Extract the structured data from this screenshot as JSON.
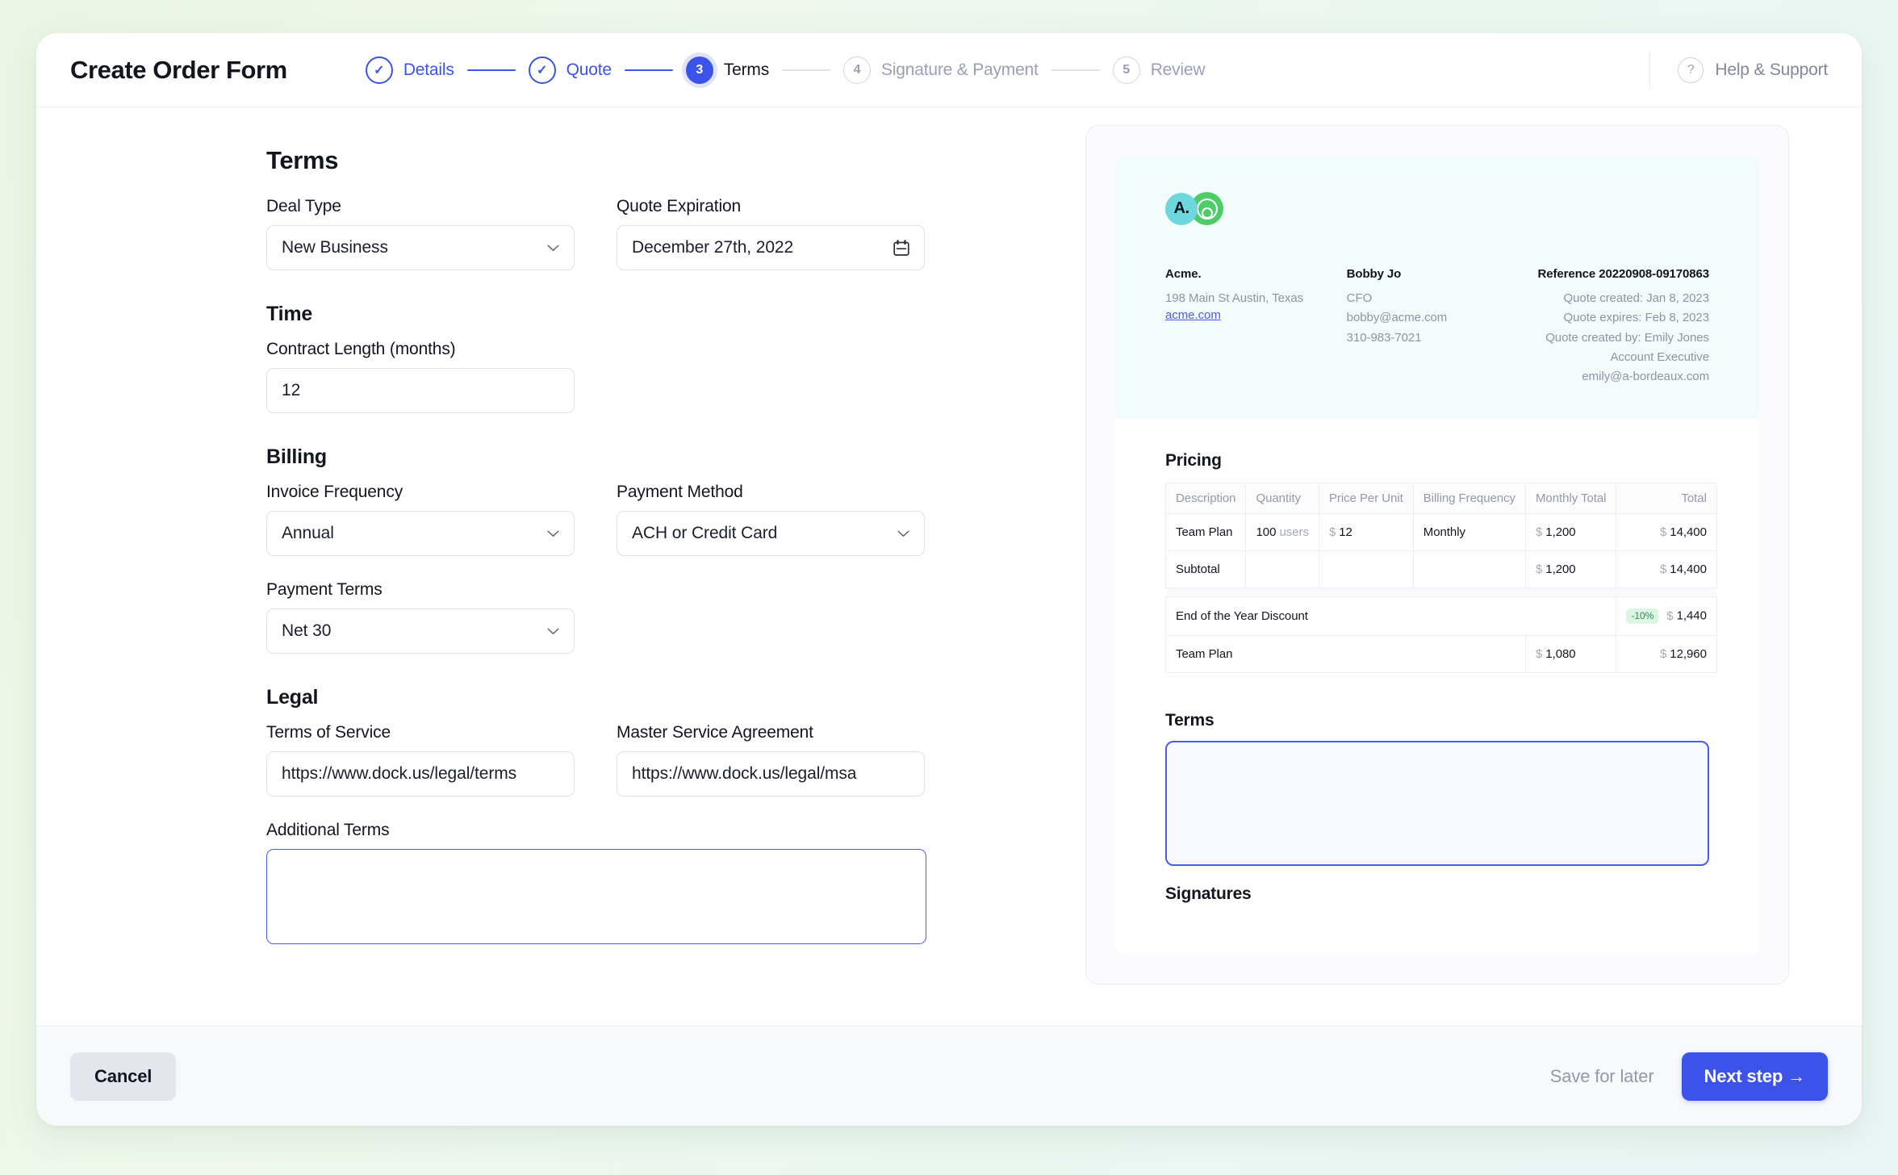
{
  "header": {
    "title": "Create Order Form",
    "help_label": "Help & Support",
    "help_icon": "question-mark-icon",
    "steps": [
      {
        "number": "1",
        "label": "Details",
        "state": "done",
        "badge": "✓"
      },
      {
        "number": "2",
        "label": "Quote",
        "state": "done",
        "badge": "✓"
      },
      {
        "number": "3",
        "label": "Terms",
        "state": "active",
        "badge": "3"
      },
      {
        "number": "4",
        "label": "Signature & Payment",
        "state": "todo",
        "badge": "4"
      },
      {
        "number": "5",
        "label": "Review",
        "state": "todo",
        "badge": "5"
      }
    ]
  },
  "form": {
    "title": "Terms",
    "deal_type": {
      "label": "Deal Type",
      "value": "New Business",
      "icon": "chevron-down-icon"
    },
    "quote_expiration": {
      "label": "Quote Expiration",
      "value": "December 27th, 2022",
      "icon": "calendar-icon"
    },
    "time_section": "Time",
    "contract_length": {
      "label": "Contract Length (months)",
      "value": "12"
    },
    "billing_section": "Billing",
    "invoice_frequency": {
      "label": "Invoice Frequency",
      "value": "Annual",
      "icon": "chevron-down-icon"
    },
    "payment_method": {
      "label": "Payment Method",
      "value": "ACH or Credit Card",
      "icon": "chevron-down-icon"
    },
    "payment_terms": {
      "label": "Payment Terms",
      "value": "Net 30",
      "icon": "chevron-down-icon"
    },
    "legal_section": "Legal",
    "terms_of_service": {
      "label": "Terms of Service",
      "value": "https://www.dock.us/legal/terms"
    },
    "master_service_agreement": {
      "label": "Master Service Agreement",
      "value": "https://www.dock.us/legal/msa"
    },
    "additional_terms": {
      "label": "Additional Terms",
      "value": "",
      "placeholder": ""
    }
  },
  "preview": {
    "logo": {
      "left_text": "A.",
      "left_color": "#6ed7dd",
      "right_color": "#4fcc6a"
    },
    "company": {
      "name": "Acme.",
      "address": "198 Main St Austin, Texas",
      "website": "acme.com"
    },
    "contact": {
      "name": "Bobby Jo",
      "title": "CFO",
      "email": "bobby@acme.com",
      "phone": "310-983-7021"
    },
    "reference": {
      "title": "Reference 20220908-09170863",
      "created": "Quote created: Jan 8, 2023",
      "expires": "Quote expires: Feb 8, 2023",
      "created_by": "Quote created by: Emily Jones",
      "role": "Account Executive",
      "email": "emily@a-bordeaux.com"
    },
    "pricing": {
      "heading": "Pricing",
      "columns": [
        "Description",
        "Quantity",
        "Price Per Unit",
        "Billing Frequency",
        "Monthly Total",
        "Total"
      ],
      "rows": [
        {
          "description": "Team Plan",
          "quantity": "100",
          "quantity_unit": "users",
          "price_per_unit": "12",
          "billing_frequency": "Monthly",
          "monthly_total": "1,200",
          "total": "14,400"
        },
        {
          "description": "Subtotal",
          "quantity": "",
          "quantity_unit": "",
          "price_per_unit": "",
          "billing_frequency": "",
          "monthly_total": "1,200",
          "total": "14,400"
        }
      ],
      "discount": {
        "description": "End of the Year Discount",
        "badge": "-10%",
        "badge_color": "#2e8a4c",
        "amount": "1,440"
      },
      "final": {
        "description": "Team Plan",
        "monthly_total": "1,080",
        "total": "12,960"
      },
      "currency_symbol": "$"
    },
    "terms_heading": "Terms",
    "terms_value": "",
    "signatures_heading": "Signatures"
  },
  "footer": {
    "cancel": "Cancel",
    "save_for_later": "Save for later",
    "next_step": "Next step →"
  },
  "colors": {
    "accent": "#3b53e8",
    "accent_light": "#dfe3fb",
    "muted": "#9399ab",
    "discount_bg": "#ddf5e3",
    "hero_bg": "#f2fcfa"
  }
}
